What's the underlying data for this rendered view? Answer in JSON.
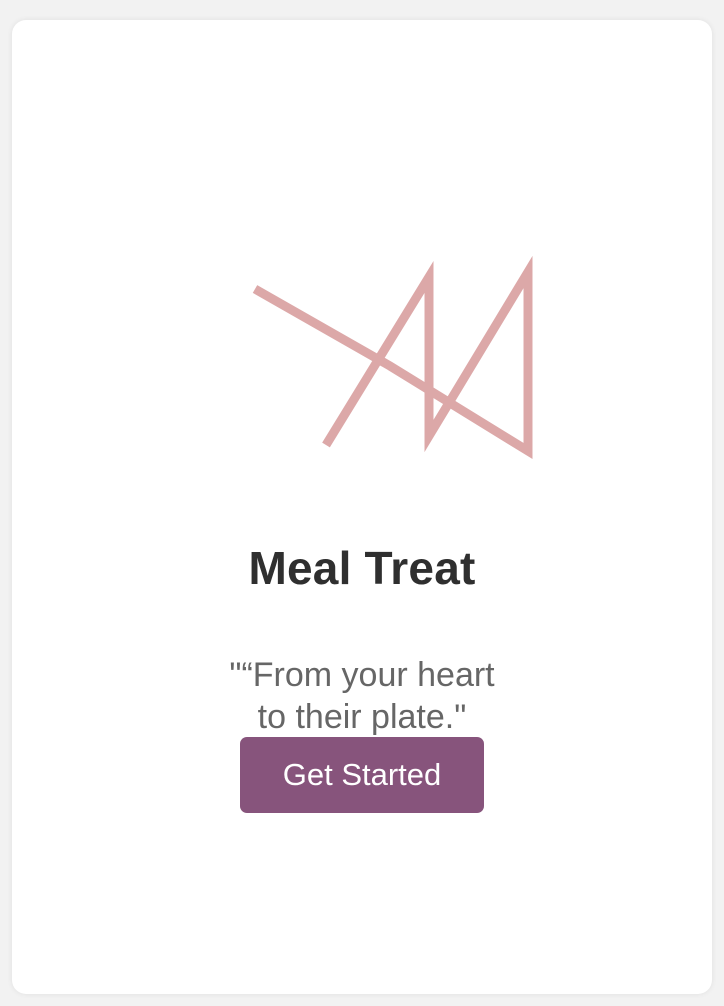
{
  "app": {
    "title": "Meal Treat",
    "tagline": "\"“From your heart to their plate.\"",
    "cta_label": "Get Started"
  },
  "logo": {
    "icon": "abstract-line-logo-icon",
    "color": "#dca8a8"
  },
  "colors": {
    "page_background": "#f2f2f2",
    "card_background": "#ffffff",
    "title": "#2f2f2f",
    "tagline": "#666666",
    "button": "#87547c",
    "button_text": "#ffffff"
  }
}
